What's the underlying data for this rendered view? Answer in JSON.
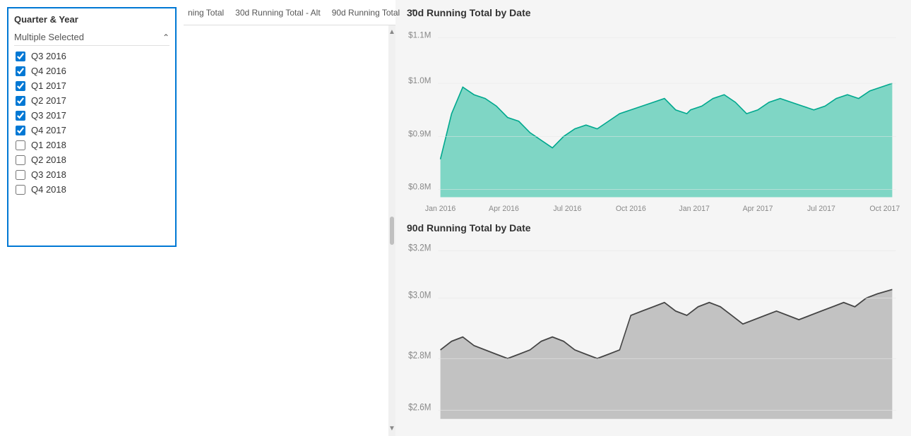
{
  "filter": {
    "title": "Quarter & Year",
    "header_label": "Multiple Selected",
    "items": [
      {
        "label": "Q3 2016",
        "checked": true
      },
      {
        "label": "Q4 2016",
        "checked": true
      },
      {
        "label": "Q1 2017",
        "checked": true
      },
      {
        "label": "Q2 2017",
        "checked": true
      },
      {
        "label": "Q3 2017",
        "checked": true
      },
      {
        "label": "Q4 2017",
        "checked": true
      },
      {
        "label": "Q1 2018",
        "checked": false
      },
      {
        "label": "Q2 2018",
        "checked": false
      },
      {
        "label": "Q3 2018",
        "checked": false
      },
      {
        "label": "Q4 2018",
        "checked": false
      }
    ]
  },
  "tabs": {
    "items": [
      {
        "label": "ning Total",
        "active": false
      },
      {
        "label": "30d Running Total - Alt",
        "active": false
      },
      {
        "label": "90d Running Total",
        "active": false
      }
    ]
  },
  "chart1": {
    "title": "30d Running Total by Date",
    "x_labels": [
      "Jan 2016",
      "Apr 2016",
      "Jul 2016",
      "Oct 2016",
      "Jan 2017",
      "Apr 2017",
      "Jul 2017",
      "Oct 2017"
    ],
    "y_labels": [
      "$0.8M",
      "$0.9M",
      "$1.0M",
      "$1.1M"
    ],
    "color_fill": "#4dc9b0",
    "color_stroke": "#00a88e"
  },
  "chart2": {
    "title": "90d Running Total by Date",
    "y_labels": [
      "$2.6M",
      "$2.8M",
      "$3.0M",
      "$3.2M"
    ],
    "color_fill": "#b8b8b8",
    "color_stroke": "#555555"
  }
}
